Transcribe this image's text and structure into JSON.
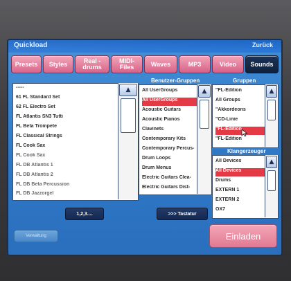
{
  "window": {
    "title": "Quickload",
    "back_label": "Zurück"
  },
  "tabs": [
    {
      "label": "Presets",
      "active": false
    },
    {
      "label": "Styles",
      "active": false
    },
    {
      "label": "Real -\ndrums",
      "active": false
    },
    {
      "label": "MIDI-\nFiles",
      "active": false
    },
    {
      "label": "Waves",
      "active": false
    },
    {
      "label": "MP3",
      "active": false
    },
    {
      "label": "Video",
      "active": false
    },
    {
      "label": "Sounds",
      "active": true
    }
  ],
  "sound_list": {
    "items": [
      {
        "label": "-----"
      },
      {
        "label": "61 FL Standard Set"
      },
      {
        "label": "62 FL Electro Set"
      },
      {
        "label": "FL Atlantis SN3 Tutti"
      },
      {
        "label": "FL Beta Trompete"
      },
      {
        "label": "FL Classical Strings"
      },
      {
        "label": "FL Cook Sax"
      },
      {
        "label": "FL Cook Sax"
      },
      {
        "label": "FL DB Atlantis 1"
      },
      {
        "label": "FL DB Atlantis 2"
      },
      {
        "label": "FL DB Beta Percussion"
      },
      {
        "label": "FL DB Jazzorgel"
      }
    ]
  },
  "benutzer_gruppen": {
    "header": "Benutzer-Gruppen",
    "items": [
      {
        "label": "All UserGroups"
      },
      {
        "label": "All UserGroups",
        "selected": true
      },
      {
        "label": "Acoustic Guitars"
      },
      {
        "label": "Acoustic Pianos"
      },
      {
        "label": "Clavinets"
      },
      {
        "label": "Contemporary Kits"
      },
      {
        "label": "Contemporary Percus-"
      },
      {
        "label": "Drum Loops"
      },
      {
        "label": "Drum Menus"
      },
      {
        "label": "Electric Guitars Clea-"
      },
      {
        "label": "Electric Guitars Dist-"
      }
    ]
  },
  "gruppen": {
    "header": "Gruppen",
    "items": [
      {
        "label": "\"FL-Edition"
      },
      {
        "label": "All Groups"
      },
      {
        "label": "\"Akkordeons"
      },
      {
        "label": "\"CD-Linie"
      },
      {
        "label": "\"FL-Edition",
        "selected": true
      },
      {
        "label": "\"FL-Edition"
      }
    ]
  },
  "klangerzeuger": {
    "header": "Klangerzeuger",
    "items": [
      {
        "label": "All Devices"
      },
      {
        "label": "All Devices",
        "selected": true
      },
      {
        "label": "Drums"
      },
      {
        "label": "EXTERN 1"
      },
      {
        "label": "EXTERN 2"
      },
      {
        "label": "OX7"
      }
    ]
  },
  "buttons": {
    "numbers_label": "1,2,3....",
    "keyboard_label": ">>> Tastatur",
    "verwaltung_label": "Verwaltung",
    "einladen_label": "Einladen"
  },
  "icons": {
    "scroll_up": "scroll-up-arrow-icon",
    "cursor": "mouse-pointer-icon"
  },
  "colors": {
    "tab_pink": "#d65f86",
    "tab_active": "#0f223d",
    "selection_red": "#e33a45",
    "screen_blue": "#2f78c6"
  }
}
